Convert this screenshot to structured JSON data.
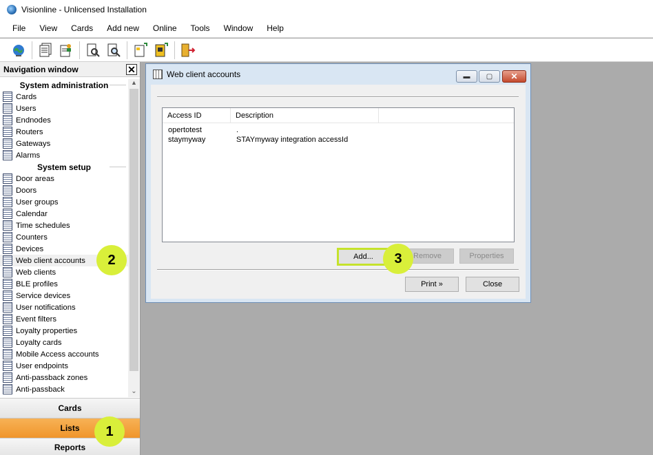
{
  "window": {
    "title": "Visionline - Unlicensed Installation"
  },
  "menu": [
    "File",
    "View",
    "Cards",
    "Add new",
    "Online",
    "Tools",
    "Window",
    "Help"
  ],
  "toolbar": {
    "icons": [
      "online-globe-icon",
      "report-icon",
      "report-user-icon",
      "search-card-icon",
      "search-doc-icon",
      "new-card-icon",
      "new-card-key-icon",
      "exit-door-icon"
    ]
  },
  "nav": {
    "title": "Navigation window",
    "close": "✕",
    "sections": [
      {
        "title": "System administration",
        "items": [
          "Cards",
          "Users",
          "Endnodes",
          "Routers",
          "Gateways",
          "Alarms"
        ]
      },
      {
        "title": "System setup",
        "items": [
          "Door areas",
          "Doors",
          "User groups",
          "Calendar",
          "Time schedules",
          "Counters",
          "Devices",
          "Web client accounts",
          "Web clients",
          "BLE profiles",
          "Service devices",
          "User notifications",
          "Event filters",
          "Loyalty properties",
          "Loyalty cards",
          "Mobile Access accounts",
          "User endpoints",
          "Anti-passback zones",
          "Anti-passback"
        ]
      }
    ],
    "selected": "Web client accounts",
    "bottom_buttons": {
      "cards": "Cards",
      "lists": "Lists",
      "reports": "Reports"
    }
  },
  "dialog": {
    "title": "Web client accounts",
    "columns": [
      "Access ID",
      "Description",
      ""
    ],
    "rows": [
      [
        "opertotest",
        "."
      ],
      [
        "staymyway",
        "STAYmyway integration accessId"
      ]
    ],
    "buttons": {
      "add": "Add...",
      "remove": "Remove",
      "properties": "Properties",
      "print": "Print »",
      "close": "Close"
    }
  },
  "annotations": {
    "step1": "1",
    "step2": "2",
    "step3": "3"
  },
  "colors": {
    "highlight": "#d9ef3a",
    "lists_tab": "#f0952b"
  }
}
